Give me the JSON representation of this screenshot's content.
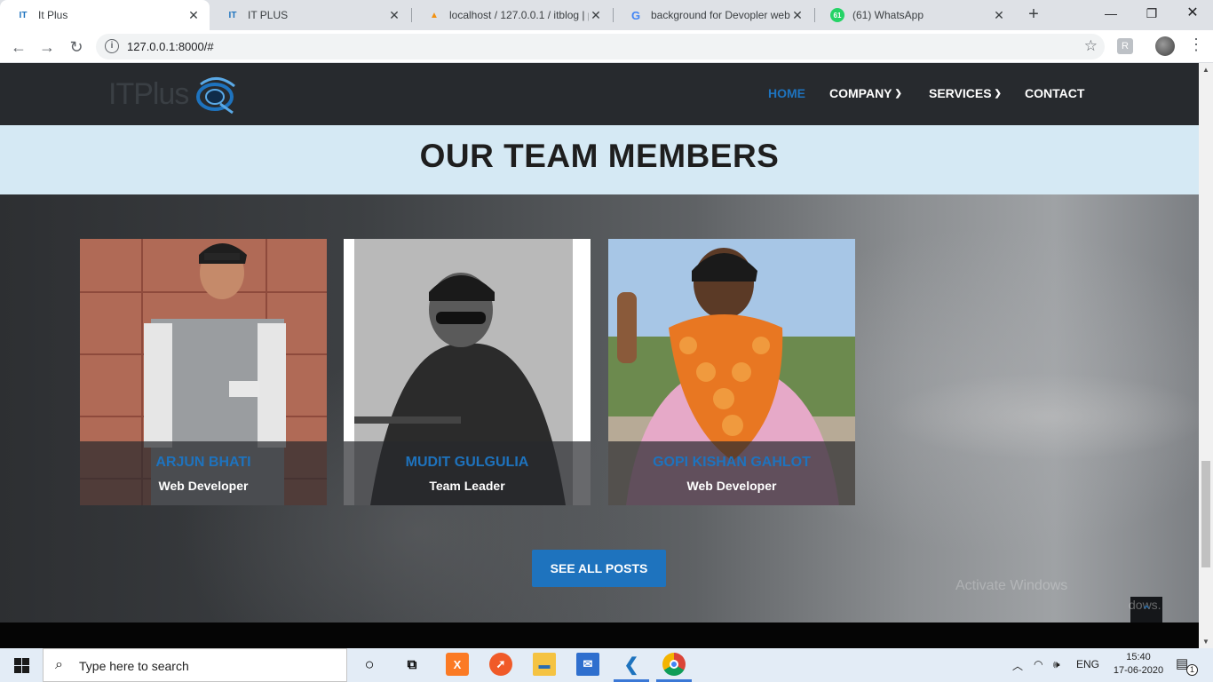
{
  "browser": {
    "tabs": [
      {
        "title": "It Plus",
        "active": true
      },
      {
        "title": "IT PLUS",
        "active": false
      },
      {
        "title": "localhost / 127.0.0.1 / itblog | p",
        "active": false
      },
      {
        "title": "background for Devopler web",
        "active": false
      },
      {
        "title": "(61) WhatsApp",
        "active": false
      }
    ],
    "whatsapp_badge": "61",
    "url": "127.0.0.1:8000/#"
  },
  "site": {
    "logo_text": "ITPlus",
    "nav": {
      "home": "HOME",
      "company": "COMPANY",
      "services": "SERVICES",
      "contact": "CONTACT"
    },
    "section_title": "OUR TEAM MEMBERS",
    "team": [
      {
        "name": "ARJUN BHATI",
        "role": "Web Developer"
      },
      {
        "name": "MUDIT GULGULIA",
        "role": "Team Leader"
      },
      {
        "name": "GOPI KISHAN GAHLOT",
        "role": "Web Developer"
      }
    ],
    "see_all_label": "SEE ALL POSTS",
    "activate_overlay": "Activate Windows",
    "watermark_fragment": "dows."
  },
  "taskbar": {
    "search_placeholder": "Type here to search",
    "language": "ENG",
    "time": "15:40",
    "date": "17-06-2020",
    "notification_count": "1"
  },
  "colors": {
    "accent": "#1e73be",
    "nav_bg": "#272a2e",
    "title_band": "#d5e9f4"
  }
}
